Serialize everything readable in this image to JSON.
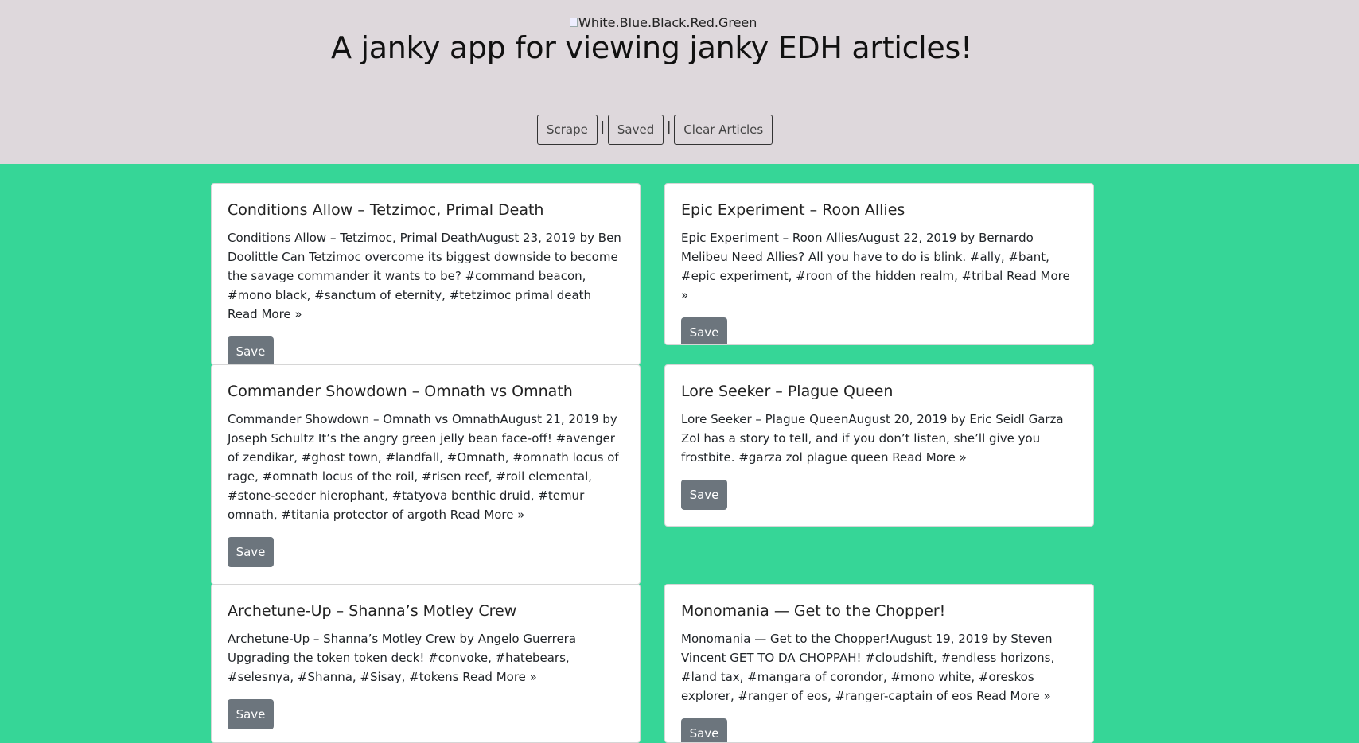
{
  "header": {
    "logo_alt": "White.Blue.Black.Red.Green",
    "title": "A janky app for viewing janky EDH articles!",
    "nav": {
      "scrape_label": "Scrape",
      "separator_1": "|",
      "saved_label": "Saved",
      "separator_2": "|",
      "clear_label": "Clear Articles"
    }
  },
  "articles": [
    {
      "title": "Conditions Allow – Tetzimoc, Primal Death",
      "summary": "Conditions Allow – Tetzimoc, Primal DeathAugust 23, 2019 by Ben Doolittle Can Tetzimoc overcome its biggest downside to become the savage commander it wants to be? #command beacon, #mono black, #sanctum of eternity, #tetzimoc primal death Read More »",
      "save_label": "Save"
    },
    {
      "title": "Epic Experiment – Roon Allies",
      "summary": "Epic Experiment – Roon AlliesAugust 22, 2019 by Bernardo Melibeu Need Allies? All you have to do is blink. #ally, #bant, #epic experiment, #roon of the hidden realm, #tribal Read More »",
      "save_label": "Save"
    },
    {
      "title": "Commander Showdown – Omnath vs Omnath",
      "summary": "Commander Showdown – Omnath vs OmnathAugust 21, 2019 by Joseph Schultz It’s the angry green jelly bean face-off! #avenger of zendikar, #ghost town, #landfall, #Omnath, #omnath locus of rage, #omnath locus of the roil, #risen reef, #roil elemental, #stone-seeder hierophant, #tatyova benthic druid, #temur omnath, #titania protector of argoth Read More »",
      "save_label": "Save"
    },
    {
      "title": "Lore Seeker – Plague Queen",
      "summary": "Lore Seeker – Plague QueenAugust 20, 2019 by Eric Seidl Garza Zol has a story to tell, and if you don’t listen, she’ll give you frostbite. #garza zol plague queen Read More »",
      "save_label": "Save"
    },
    {
      "title": "Archetune-Up – Shanna’s Motley Crew",
      "summary": "Archetune-Up – Shanna’s Motley Crew by Angelo Guerrera Upgrading the token token deck! #convoke, #hatebears, #selesnya, #Shanna, #Sisay, #tokens Read More »",
      "save_label": "Save"
    },
    {
      "title": "Monomania — Get to the Chopper!",
      "summary": "Monomania — Get to the Chopper!August 19, 2019 by Steven Vincent GET TO DA CHOPPAH! #cloudshift, #endless horizons, #land tax, #mangara of corondor, #mono white, #oreskos explorer, #ranger of eos, #ranger-captain of eos Read More »",
      "save_label": "Save"
    }
  ]
}
